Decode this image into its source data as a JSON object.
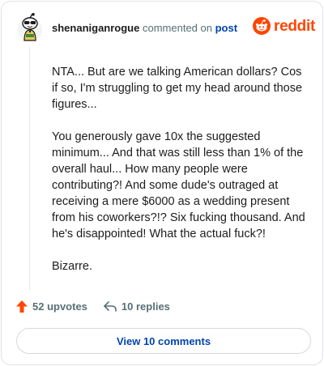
{
  "comment": {
    "username": "shenaniganrogue",
    "action_text": "commented on",
    "post_link": "post",
    "paragraphs": [
      "NTA... But are we talking American dollars? Cos if so, I'm struggling to get my head around those figures...",
      "You generously gave 10x the suggested minimum... And that was still less than 1% of the overall haul... How many people were contributing?! And some dude's outraged at receiving a mere $6000 as a wedding present from his coworkers?!? Six fucking thousand. And he's disappointed! What the actual fuck?!",
      "Bizarre."
    ]
  },
  "branding": {
    "logo_text": "reddit",
    "brand_color": "#ff4500"
  },
  "actions": {
    "upvotes_label": "52 upvotes",
    "replies_label": "10 replies"
  },
  "footer": {
    "view_comments_label": "View 10 comments"
  },
  "icons": {
    "upvote": "arrow-up-icon",
    "reply": "reply-arrow-icon",
    "logo": "reddit-snoo-icon"
  }
}
